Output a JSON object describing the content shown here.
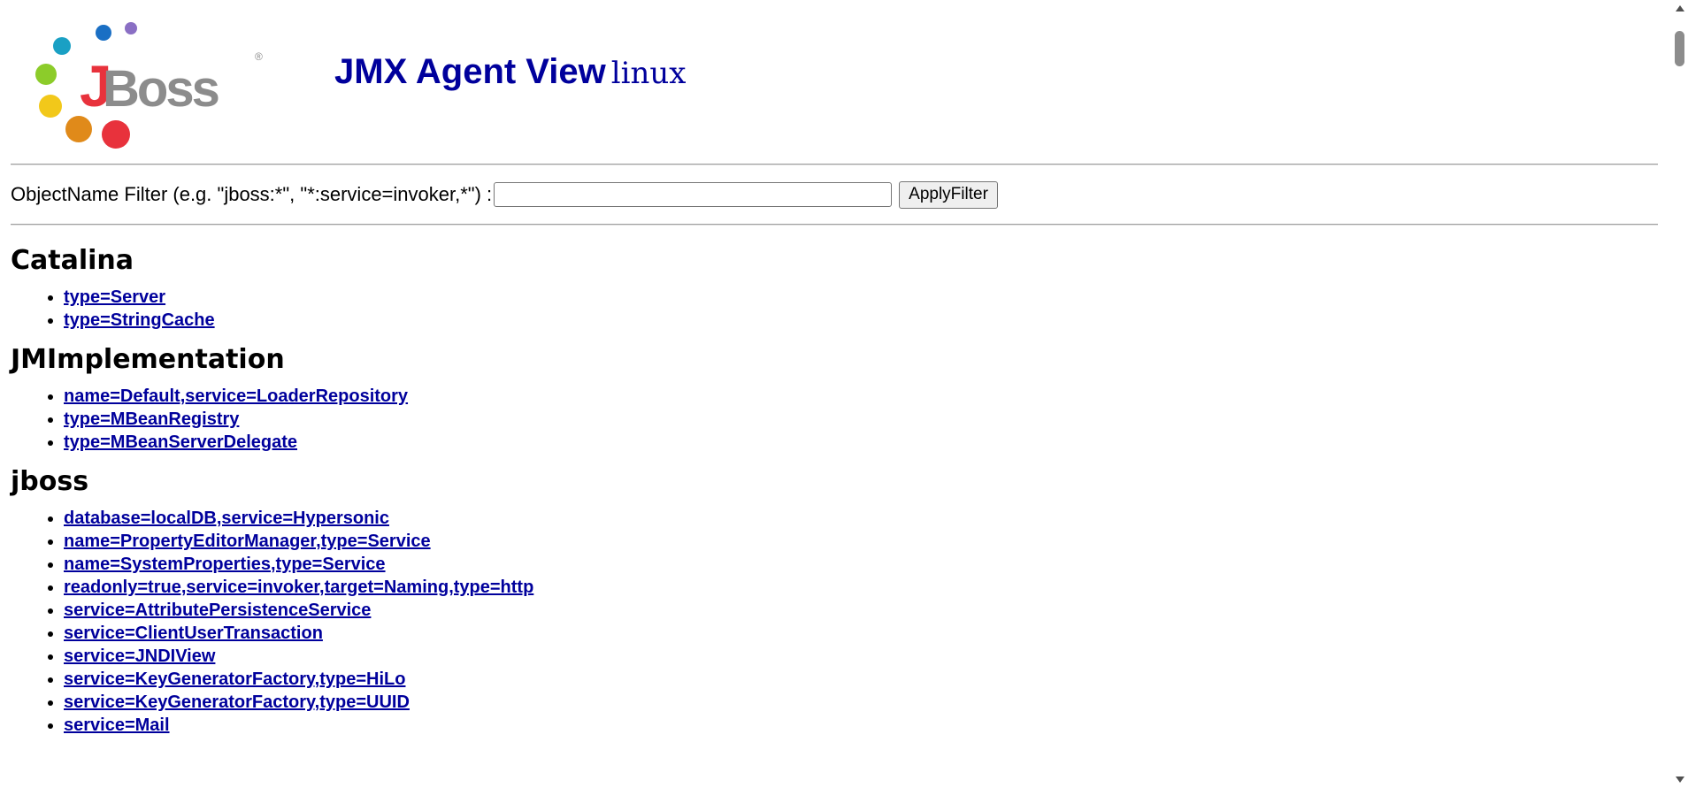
{
  "header": {
    "logo_text": "JBoss",
    "title": "JMX Agent View",
    "hostname": "linux"
  },
  "filter": {
    "label": "ObjectName Filter (e.g. \"jboss:*\", \"*:service=invoker,*\") :",
    "value": "",
    "button_label": "ApplyFilter"
  },
  "domains": [
    {
      "name": "Catalina",
      "mbeans": [
        "type=Server",
        "type=StringCache"
      ]
    },
    {
      "name": "JMImplementation",
      "mbeans": [
        "name=Default,service=LoaderRepository",
        "type=MBeanRegistry",
        "type=MBeanServerDelegate"
      ]
    },
    {
      "name": "jboss",
      "mbeans": [
        "database=localDB,service=Hypersonic",
        "name=PropertyEditorManager,type=Service",
        "name=SystemProperties,type=Service",
        "readonly=true,service=invoker,target=Naming,type=http",
        "service=AttributePersistenceService",
        "service=ClientUserTransaction",
        "service=JNDIView",
        "service=KeyGeneratorFactory,type=HiLo",
        "service=KeyGeneratorFactory,type=UUID",
        "service=Mail"
      ]
    }
  ],
  "colors": {
    "title": "#00009c",
    "link": "#00009c",
    "logo_red": "#e8323c",
    "logo_gray": "#8c8c8c"
  }
}
